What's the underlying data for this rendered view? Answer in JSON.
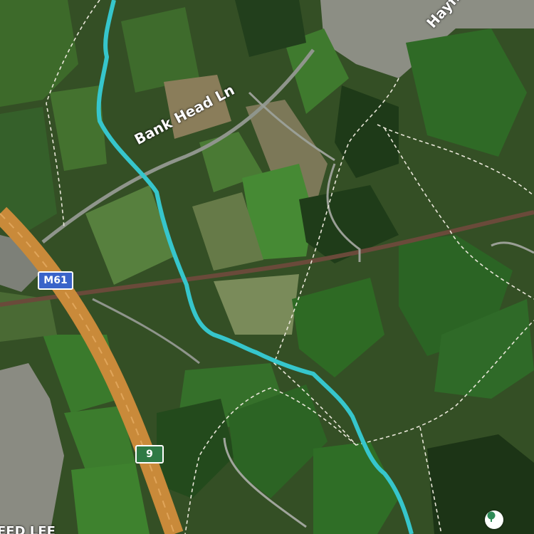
{
  "map": {
    "view": "satellite",
    "labels": {
      "road_bank_head": "Bank Head Ln",
      "road_hayfield_partial": "Hayfie",
      "area_bottom_partial": "EED LEE"
    },
    "shields": {
      "motorway": {
        "text": "M61",
        "color": "#3a63c9"
      },
      "junction": {
        "text": "9",
        "color": "#2f7a45"
      }
    },
    "route": {
      "color": "#36c6cc"
    },
    "poi": {
      "icon": "tree-icon",
      "color": "#2e8b57"
    }
  }
}
